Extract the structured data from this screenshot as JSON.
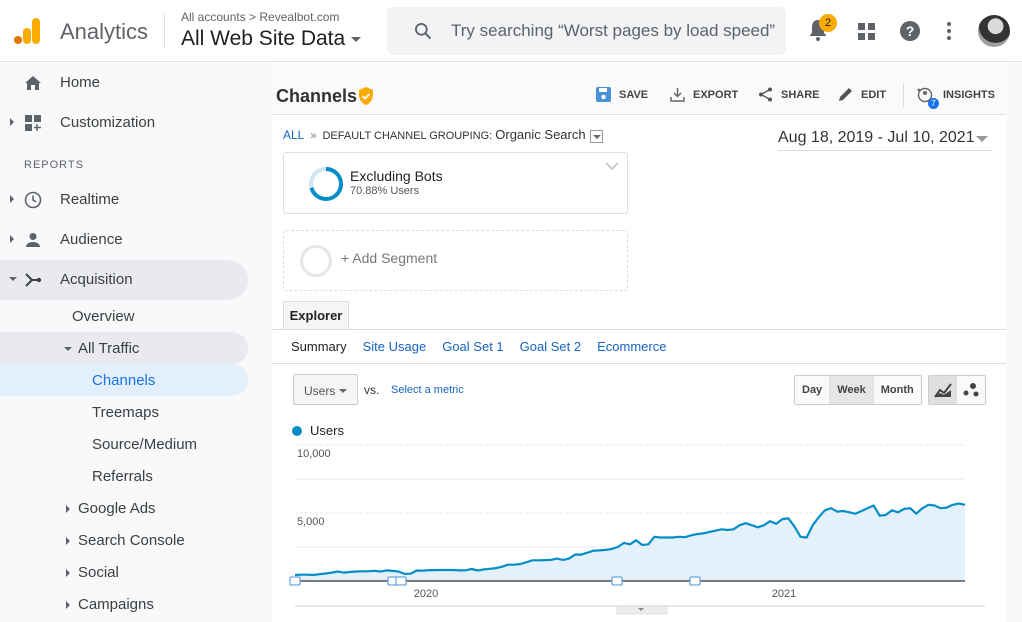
{
  "header": {
    "brand": "Analytics",
    "breadcrumb": "All accounts > Revealbot.com",
    "property": "All Web Site Data",
    "search_placeholder": "Try searching “Worst pages by load speed”",
    "notification_count": "2",
    "icons": [
      "bell-icon",
      "apps-grid-icon",
      "help-icon",
      "more-vert-icon",
      "avatar"
    ],
    "brand_color": "#f9ab00"
  },
  "sidebar": {
    "top_items": [
      {
        "label": "Home",
        "icon": "home-icon"
      },
      {
        "label": "Customization",
        "icon": "dashboard-icon"
      }
    ],
    "section_label": "REPORTS",
    "report_items": [
      {
        "label": "Realtime",
        "icon": "clock-icon"
      },
      {
        "label": "Audience",
        "icon": "person-icon"
      },
      {
        "label": "Acquisition",
        "icon": "acquisition-icon"
      }
    ],
    "acquisition_children": [
      {
        "label": "Overview"
      },
      {
        "label": "All Traffic"
      },
      {
        "label": "Channels"
      },
      {
        "label": "Treemaps"
      },
      {
        "label": "Source/Medium"
      },
      {
        "label": "Referrals"
      },
      {
        "label": "Google Ads"
      },
      {
        "label": "Search Console"
      },
      {
        "label": "Social"
      },
      {
        "label": "Campaigns"
      }
    ]
  },
  "main": {
    "title": "Channels",
    "toolbar": {
      "save": "SAVE",
      "export": "EXPORT",
      "share": "SHARE",
      "edit": "EDIT",
      "insights": "INSIGHTS",
      "insights_count": "7"
    },
    "breadcrumb": {
      "all": "ALL",
      "sep": "»",
      "grouping": "DEFAULT CHANNEL GROUPING:",
      "value": "Organic Search"
    },
    "date_range": "Aug 18, 2019 - Jul 10, 2021",
    "segment": {
      "name": "Excluding Bots",
      "detail": "70.88% Users",
      "percent": 70.88
    },
    "add_segment": "+ Add Segment",
    "explorer_tab": "Explorer",
    "subtabs": [
      "Summary",
      "Site Usage",
      "Goal Set 1",
      "Goal Set 2",
      "Ecommerce"
    ],
    "metric_select": "Users",
    "vs": "vs.",
    "select_metric": "Select a metric",
    "granularity": [
      "Day",
      "Week",
      "Month"
    ],
    "granularity_selected": "Week"
  },
  "chart_data": {
    "type": "area",
    "series": [
      {
        "name": "Users",
        "color": "#058dc7",
        "values": [
          450,
          460,
          460,
          440,
          500,
          550,
          610,
          700,
          620,
          660,
          700,
          710,
          710,
          750,
          700,
          780,
          740,
          700,
          520,
          540,
          770,
          760,
          800,
          800,
          810,
          810,
          810,
          780,
          790,
          880,
          770,
          850,
          900,
          950,
          1050,
          1200,
          1200,
          1250,
          1380,
          1520,
          1520,
          1540,
          1550,
          1650,
          1550,
          1650,
          1950,
          1940,
          2080,
          2230,
          2250,
          2290,
          2350,
          2500,
          2800,
          2700,
          3000,
          2650,
          2700,
          3250,
          3200,
          3200,
          3200,
          3250,
          3220,
          3350,
          3450,
          3500,
          3600,
          3700,
          3800,
          3750,
          3800,
          4100,
          4250,
          4100,
          3950,
          4100,
          4400,
          4200,
          4550,
          4600,
          4000,
          3250,
          3200,
          4100,
          4700,
          5200,
          5350,
          5100,
          5150,
          5050,
          4950,
          5150,
          5350,
          5550,
          4800,
          4850,
          5200,
          5050,
          5300,
          5350,
          4950,
          5350,
          5600,
          5550,
          5350,
          5400,
          5600,
          5700,
          5600
        ],
        "annotation_markers": 5
      }
    ],
    "title": "",
    "legend": [
      "Users"
    ],
    "legend_position": "top-left",
    "x_tick_labels": [
      "2020",
      "2021"
    ],
    "y_tick_labels": [
      "5,000",
      "10,000"
    ],
    "ylim": [
      0,
      10000
    ],
    "xlim": [
      "Aug 18, 2019",
      "Jul 10, 2021"
    ],
    "grid": true
  }
}
